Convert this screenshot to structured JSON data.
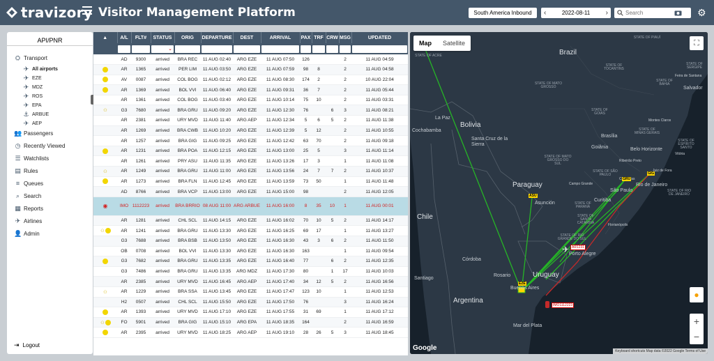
{
  "header": {
    "brand": "travizory",
    "title": "Visitor Management Platform",
    "direction_select": "South America Inbound",
    "date": "2022-08-11",
    "search_placeholder": "Search"
  },
  "sidebar": {
    "title": "API/PNR",
    "transport": "Transport",
    "airports": [
      "All airports",
      "EZE",
      "MDZ",
      "ROS",
      "EPA",
      "ARBUE",
      "AEP"
    ],
    "menu": [
      "Passengers",
      "Recently Viewed",
      "Watchlists",
      "Rules",
      "Queues",
      "Search",
      "Reports",
      "Airlines",
      "Admin"
    ],
    "logout": "Logout"
  },
  "table": {
    "columns": [
      "▲",
      "A/L",
      "FLT#",
      "STATUS",
      "ORIG",
      "DEPARTURE",
      "DEST",
      "ARRIVAL",
      "PAX",
      "TRF",
      "CRW",
      "MSG",
      "UPDATED"
    ],
    "rows": [
      [
        "",
        "AD",
        "9300",
        "arrived",
        "BRA REC",
        "11 AUG 02:40",
        "ARG EZE",
        "11 AUG 07:50",
        "126",
        "",
        "",
        "2",
        "11 AUG 04:59"
      ],
      [
        "y",
        "AR",
        "1365",
        "arrived",
        "PER LIM",
        "11 AUG 03:50",
        "ARG EZE",
        "11 AUG 07:59",
        "98",
        "8",
        "",
        "2",
        "11 AUG 04:58"
      ],
      [
        "y",
        "AV",
        "0087",
        "arrived",
        "COL BOG",
        "11 AUG 02:12",
        "ARG EZE",
        "11 AUG 08:30",
        "174",
        "2",
        "",
        "2",
        "10 AUG 22:04"
      ],
      [
        "y",
        "AR",
        "1369",
        "arrived",
        "BOL VVI",
        "11 AUG 06:40",
        "ARG EZE",
        "11 AUG 09:31",
        "36",
        "7",
        "",
        "2",
        "11 AUG 05:44"
      ],
      [
        "",
        "AR",
        "1361",
        "arrived",
        "COL BOG",
        "11 AUG 03:40",
        "ARG EZE",
        "11 AUG 10:14",
        "75",
        "10",
        "",
        "2",
        "11 AUG 03:31"
      ],
      [
        "g",
        "G3",
        "7680",
        "arrived",
        "BRA GRU",
        "11 AUG 09:20",
        "ARG EZE",
        "11 AUG 12:30",
        "76",
        "",
        "6",
        "3",
        "11 AUG 08:21"
      ],
      [
        "",
        "AR",
        "2381",
        "arrived",
        "URY MVD",
        "11 AUG 11:40",
        "ARG AEP",
        "11 AUG 12:34",
        "5",
        "6",
        "5",
        "2",
        "11 AUG 11:38"
      ],
      [
        "",
        "AR",
        "1269",
        "arrived",
        "BRA CWB",
        "11 AUG 10:20",
        "ARG EZE",
        "11 AUG 12:39",
        "5",
        "12",
        "",
        "2",
        "11 AUG 10:55"
      ],
      [
        "",
        "AR",
        "1257",
        "arrived",
        "BRA GIG",
        "11 AUG 09:25",
        "ARG EZE",
        "11 AUG 12:42",
        "63",
        "70",
        "",
        "2",
        "11 AUG 09:18"
      ],
      [
        "y",
        "AR",
        "1231",
        "arrived",
        "BRA POA",
        "11 AUG 12:15",
        "ARG EZE",
        "11 AUG 13:00",
        "25",
        "5",
        "",
        "3",
        "11 AUG 11:14"
      ],
      [
        "",
        "AR",
        "1261",
        "arrived",
        "PRY ASU",
        "11 AUG 11:35",
        "ARG EZE",
        "11 AUG 13:26",
        "17",
        "3",
        "",
        "1",
        "11 AUG 11:08"
      ],
      [
        "g",
        "AR",
        "1249",
        "arrived",
        "BRA GRU",
        "11 AUG 11:00",
        "ARG EZE",
        "11 AUG 13:56",
        "24",
        "7",
        "7",
        "2",
        "11 AUG 10:37"
      ],
      [
        "y",
        "AR",
        "1273",
        "arrived",
        "BRA FLN",
        "11 AUG 12:45",
        "ARG EZE",
        "11 AUG 13:59",
        "73",
        "50",
        "",
        "1",
        "11 AUG 11:48"
      ],
      [
        "",
        "AD",
        "8766",
        "arrived",
        "BRA VCP",
        "11 AUG 13:00",
        "ARG EZE",
        "11 AUG 15:00",
        "98",
        "",
        "",
        "2",
        "11 AUG 12:05"
      ],
      [
        "e",
        "IMO",
        "1112223",
        "arrived",
        "BRA BRRIO",
        "08 AUG 11:00",
        "ARG ARBUE",
        "11 AUG 16:00",
        "8",
        "35",
        "10",
        "1",
        "11 AUG 00:01"
      ],
      [
        "",
        "AR",
        "1281",
        "arrived",
        "CHL SCL",
        "11 AUG 14:15",
        "ARG EZE",
        "11 AUG 16:02",
        "70",
        "10",
        "5",
        "2",
        "11 AUG 14:17"
      ],
      [
        "gy",
        "AR",
        "1241",
        "arrived",
        "BRA GRU",
        "11 AUG 13:30",
        "ARG EZE",
        "11 AUG 16:25",
        "69",
        "17",
        "",
        "1",
        "11 AUG 13:27"
      ],
      [
        "",
        "G3",
        "7688",
        "arrived",
        "BRA BSB",
        "11 AUG 13:50",
        "ARG EZE",
        "11 AUG 16:30",
        "43",
        "3",
        "6",
        "2",
        "11 AUG 11:50"
      ],
      [
        "",
        "OB",
        "0708",
        "arrived",
        "BOL VVI",
        "11 AUG 13:30",
        "ARG EZE",
        "11 AUG 16:30",
        "163",
        "",
        "",
        "1",
        "11 AUG 09:54"
      ],
      [
        "y",
        "G3",
        "7682",
        "arrived",
        "BRA GRU",
        "11 AUG 13:35",
        "ARG EZE",
        "11 AUG 16:40",
        "77",
        "",
        "6",
        "2",
        "11 AUG 12:35"
      ],
      [
        "",
        "G3",
        "7486",
        "arrived",
        "BRA GRU",
        "11 AUG 13:35",
        "ARG MDZ",
        "11 AUG 17:30",
        "80",
        "",
        "1",
        "17",
        "11 AUG 10:03"
      ],
      [
        "",
        "AR",
        "2385",
        "arrived",
        "URY MVD",
        "11 AUG 16:45",
        "ARG AEP",
        "11 AUG 17:40",
        "34",
        "12",
        "5",
        "2",
        "11 AUG 16:56"
      ],
      [
        "g",
        "AR",
        "1229",
        "arrived",
        "BRA SSA",
        "11 AUG 13:45",
        "ARG EZE",
        "11 AUG 17:47",
        "123",
        "10",
        "",
        "1",
        "11 AUG 12:53"
      ],
      [
        "",
        "H2",
        "0507",
        "arrived",
        "CHL SCL",
        "11 AUG 15:50",
        "ARG EZE",
        "11 AUG 17:50",
        "76",
        "",
        "",
        "3",
        "11 AUG 16:24"
      ],
      [
        "y",
        "AR",
        "1393",
        "arrived",
        "URY MVD",
        "11 AUG 17:10",
        "ARG EZE",
        "11 AUG 17:55",
        "31",
        "69",
        "",
        "1",
        "11 AUG 17:12"
      ],
      [
        "gy",
        "FO",
        "5901",
        "arrived",
        "BRA GIG",
        "11 AUG 15:10",
        "ARG EPA",
        "11 AUG 18:35",
        "164",
        "",
        "",
        "2",
        "11 AUG 16:59"
      ],
      [
        "y",
        "AR",
        "2395",
        "arrived",
        "URY MVD",
        "11 AUG 18:25",
        "ARG AEP",
        "11 AUG 19:10",
        "28",
        "26",
        "5",
        "3",
        "11 AUG 18:45"
      ]
    ]
  },
  "map": {
    "tab_map": "Map",
    "tab_satellite": "Satellite",
    "google": "Google",
    "attribution": "Keyboard shortcuts   Map data ©2022 Google   Terms of Use",
    "labels": {
      "brazil": "Brazil",
      "bolivia": "Bolivia",
      "paraguay": "Paraguay",
      "chile": "Chile",
      "argentina": "Argentina",
      "uruguay": "Uruguay",
      "la_paz": "La Paz",
      "cochabamba": "Cochabamba",
      "santa_cruz": "Santa Cruz de la Sierra",
      "asuncion": "Asunción",
      "cordoba": "Córdoba",
      "santiago": "Santiago",
      "buenos_aires": "Buenos Aires",
      "rosario": "Rosario",
      "sao_paulo": "São Paulo",
      "rio": "Rio de Janeiro",
      "curitiba": "Curitiba",
      "porto_alegre": "Porto Alegre",
      "brasilia": "Brasília",
      "belo_horizonte": "Belo Horizonte",
      "salvador": "Salvador",
      "goiania": "Goiânia",
      "mar_del_plata": "Mar del Plata",
      "florianopolis": "Florianópolis",
      "campo_grande": "Campo Grande",
      "campinas": "Campinas",
      "ribeirao_preto": "Ribeirão Preto",
      "juiz_de_fora": "Juiz de Fora",
      "vitoria": "Vitória",
      "montes_claros": "Montes Claros",
      "feira": "Feira de Santana"
    },
    "states": [
      "STATE OF ACRE",
      "STATE OF PIAUÍ",
      "STATE OF TOCANTINS",
      "STATE OF BAHIA",
      "STATE OF MATO GROSSO",
      "STATE OF GOIÁS",
      "STATE OF MINAS GERAIS",
      "STATE OF MATO GROSSO DO SUL",
      "STATE OF SÃO PAULO",
      "STATE OF ESPÍRITO SANTO",
      "STATE OF RIO DE JANEIRO",
      "STATE OF PARANÁ",
      "STATE OF SANTA CATARINA",
      "STATE OF RIO GRANDE DO SUL",
      "STATE OF SERGIPE"
    ],
    "pins": {
      "eze": "EZE",
      "gru": "GRU",
      "gig": "GIG",
      "asu": "ASU",
      "fln": "FLN"
    },
    "ship": "IMO1112223",
    "plane": "AR1231"
  }
}
